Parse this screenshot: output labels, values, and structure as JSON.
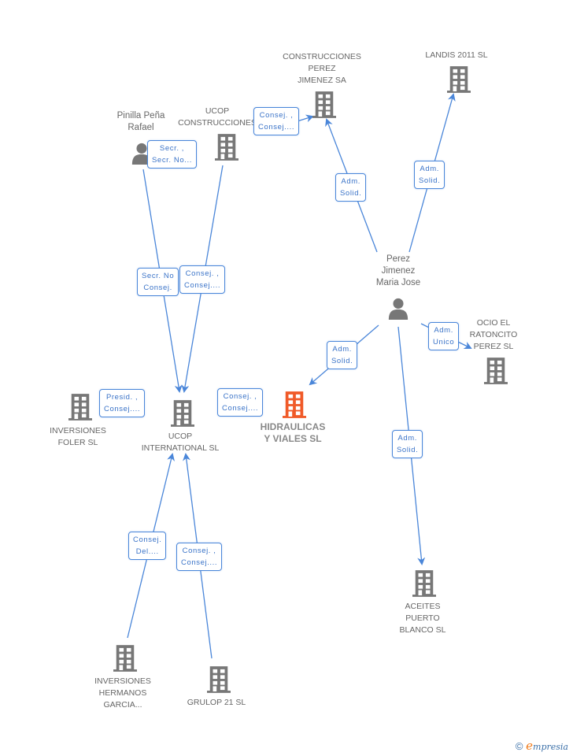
{
  "colors": {
    "edge": "#4a86d9",
    "node_gray": "#777777",
    "focus_node": "#f05a28",
    "text_gray": "#666666"
  },
  "nodes": {
    "pinilla": {
      "label": "Pinilla Peña\nRafael",
      "type": "person"
    },
    "ucop_construcciones": {
      "label": "UCOP\nCONSTRUCCIONES",
      "type": "company"
    },
    "construcciones_perez": {
      "label": "CONSTRUCCIONES\nPEREZ\nJIMENEZ SA",
      "type": "company"
    },
    "landis": {
      "label": "LANDIS 2011 SL",
      "type": "company"
    },
    "perez_jimenez": {
      "label": "Perez\nJimenez\nMaria Jose",
      "type": "person"
    },
    "ocio": {
      "label": "OCIO EL\nRATONCITO\nPEREZ SL",
      "type": "company"
    },
    "inversiones_foler": {
      "label": "INVERSIONES\nFOLER SL",
      "type": "company"
    },
    "ucop_international": {
      "label": "UCOP\nINTERNATIONAL SL",
      "type": "company"
    },
    "hidraulicas": {
      "label": "HIDRAULICAS\nY VIALES SL",
      "type": "focus"
    },
    "aceites": {
      "label": "ACEITES\nPUERTO\nBLANCO SL",
      "type": "company"
    },
    "inversiones_garcia": {
      "label": "INVERSIONES\nHERMANOS\nGARCIA...",
      "type": "company"
    },
    "grulop": {
      "label": "GRULOP 21 SL",
      "type": "company"
    }
  },
  "edge_labels": {
    "pinilla_ucopc": "Secr. ,\nSecr. No...",
    "ucopc_cpj": "Consej. ,\nConsej....",
    "pj_cpj": "Adm.\nSolid.",
    "pj_landis": "Adm.\nSolid.",
    "pinilla_ucopi": "Secr.  No\nConsej.",
    "ucopc_ucopi": "Consej. ,\nConsej....",
    "pj_ocio": "Adm.\nUnico",
    "pj_hidraulicas": "Adm.\nSolid.",
    "foler_ucopi": "Presid. ,\nConsej....",
    "ucopi_hidraulicas": "Consej. ,\nConsej....",
    "pj_aceites": "Adm.\nSolid.",
    "garcia_ucopi": "Consej.\nDel....",
    "grulop_ucopi": "Consej. ,\nConsej...."
  },
  "footer": {
    "copyright_symbol": "©",
    "brand_initial": "e",
    "brand_rest": "mpresia"
  }
}
